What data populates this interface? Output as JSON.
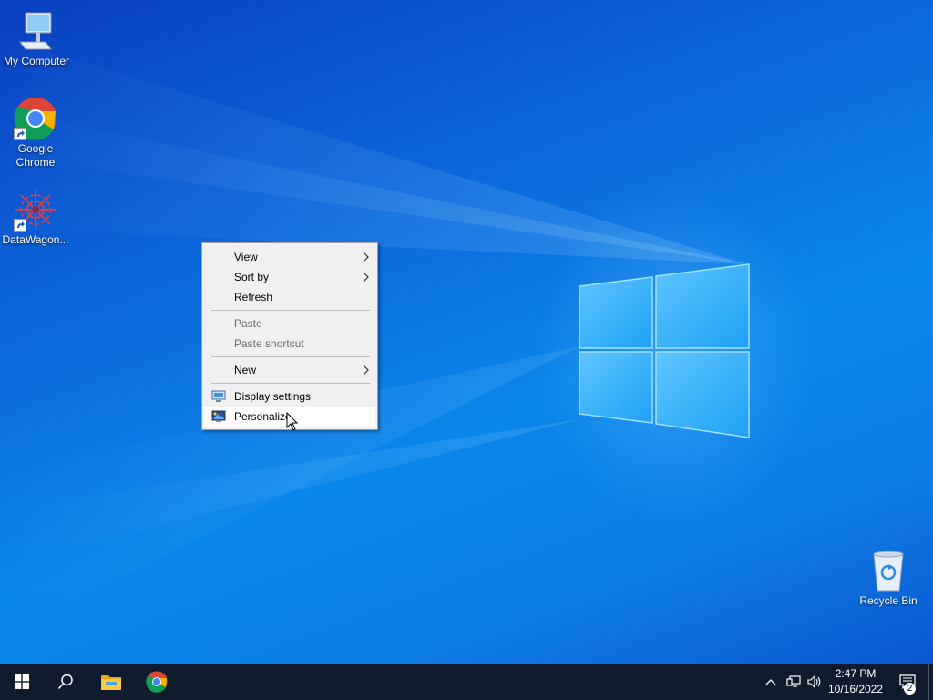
{
  "desktop": {
    "icons": [
      {
        "label": "My Computer",
        "icon": "computer-icon"
      },
      {
        "label": "Google\nChrome",
        "label_line1": "Google",
        "label_line2": "Chrome",
        "icon": "chrome-icon"
      },
      {
        "label": "DataWagon...",
        "icon": "datawagon-icon"
      },
      {
        "label": "Recycle Bin",
        "icon": "recycle-bin-icon"
      }
    ]
  },
  "context_menu": {
    "items": [
      {
        "label": "View",
        "has_submenu": true,
        "enabled": true
      },
      {
        "label": "Sort by",
        "has_submenu": true,
        "enabled": true
      },
      {
        "label": "Refresh",
        "has_submenu": false,
        "enabled": true
      },
      {
        "label": "Paste",
        "has_submenu": false,
        "enabled": false
      },
      {
        "label": "Paste shortcut",
        "has_submenu": false,
        "enabled": false
      },
      {
        "label": "New",
        "has_submenu": true,
        "enabled": true
      },
      {
        "label": "Display settings",
        "has_submenu": false,
        "enabled": true,
        "icon": "display-settings-icon"
      },
      {
        "label": "Personalize",
        "has_submenu": false,
        "enabled": true,
        "icon": "personalize-icon",
        "highlighted": true
      }
    ]
  },
  "taskbar": {
    "start_icon": "windows-start-icon",
    "search_icon": "search-icon",
    "pinned": [
      "file-explorer-icon",
      "chrome-icon"
    ],
    "tray_icons": [
      "chevron-up-icon",
      "network-icon",
      "volume-icon"
    ],
    "clock": {
      "time": "2:47 PM",
      "date": "10/16/2022"
    },
    "notifications": {
      "count": "2"
    }
  },
  "colors": {
    "desktop_blue": "#0b63d8",
    "taskbar": "#101b2e",
    "menu_bg": "#f0f0f0",
    "menu_highlight": "#ffffff",
    "disabled_text": "#6d6d6d"
  }
}
